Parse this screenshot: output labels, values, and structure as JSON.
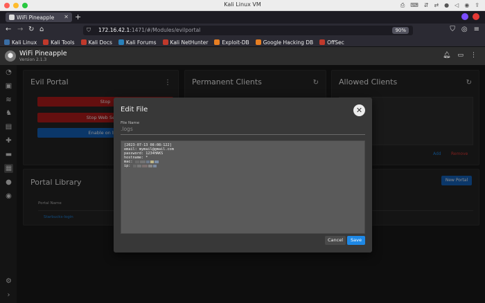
{
  "window": {
    "title": "Kali Linux VM"
  },
  "browser": {
    "tab": {
      "title": "WiFi Pineapple"
    },
    "url": {
      "host": "172.16.42.1",
      "path": ":1471/#/Modules/evilportal"
    },
    "zoom": "90%",
    "bookmarks": [
      {
        "label": "Kali Linux",
        "color": "#3a6ea5"
      },
      {
        "label": "Kali Tools",
        "color": "#c0392b"
      },
      {
        "label": "Kali Docs",
        "color": "#c0392b"
      },
      {
        "label": "Kali Forums",
        "color": "#2980b9"
      },
      {
        "label": "Kali NetHunter",
        "color": "#c0392b"
      },
      {
        "label": "Exploit-DB",
        "color": "#e67e22"
      },
      {
        "label": "Google Hacking DB",
        "color": "#e67e22"
      },
      {
        "label": "OffSec",
        "color": "#c0392b"
      }
    ]
  },
  "app": {
    "title": "WiFi Pineapple",
    "version": "Version 2.1.3"
  },
  "cards": {
    "evil_portal": {
      "title": "Evil Portal",
      "buttons": [
        "Stop",
        "Stop Web Server",
        "Enable on boot"
      ]
    },
    "permanent_clients": {
      "title": "Permanent Clients"
    },
    "allowed_clients": {
      "title": "Allowed Clients",
      "add": "Add",
      "remove": "Remove"
    },
    "portal_library": {
      "title": "Portal Library",
      "new_portal": "New Portal",
      "column_header": "Portal Name",
      "rows": [
        "Starbucks-login"
      ]
    }
  },
  "modal": {
    "title": "Edit File",
    "file_name_label": "File Name",
    "file_name_value": ".logs",
    "content": {
      "line1": "[2023-07-13 08:08:122]",
      "line2": "email: mymail@gmail.com",
      "line3": "password: 1234HAKS",
      "line4": "hostname: *",
      "line5": "mac:",
      "line6": "ip:"
    },
    "cancel": "Cancel",
    "save": "Save"
  },
  "colors": {
    "stop_red": "#b71c1c",
    "action_blue": "#1565c0",
    "save_blue": "#1e88e5"
  }
}
